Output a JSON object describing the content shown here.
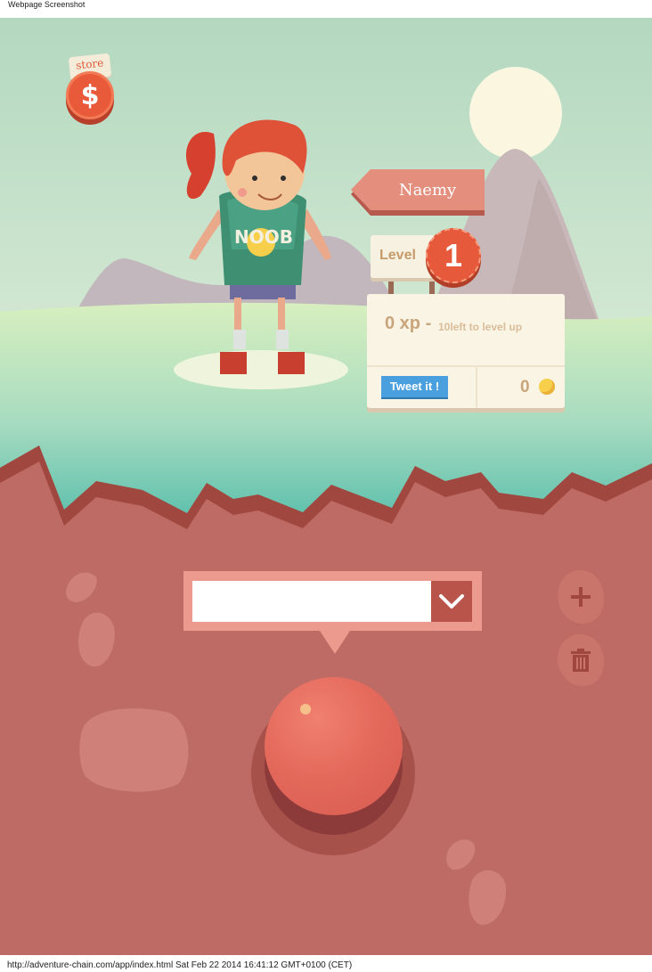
{
  "window": {
    "title": "Webpage Screenshot",
    "footer": "http://adventure-chain.com/app/index.html Sat Feb 22 2014 16:41:12 GMT+0100 (CET)"
  },
  "store": {
    "label": "store",
    "symbol": "$"
  },
  "player": {
    "name": "Naemy",
    "shirt_text": "NOOB",
    "level_label": "Level",
    "level": "1",
    "xp_text": "0 xp -",
    "xp_sub": "10left to level up",
    "tweet_label": "Tweet it !",
    "coins": "0"
  },
  "composer": {
    "input_value": "",
    "placeholder": ""
  },
  "colors": {
    "sky_top": "#b7dcc4",
    "grass": "#c7e9b3",
    "ground": "#bd6b64",
    "accent_red": "#e6593a",
    "tweet_blue": "#4a9fde"
  },
  "icons": {
    "store": "dollar-coin-icon",
    "toggle": "chevron-down-icon",
    "add": "plus-icon",
    "delete": "trash-icon",
    "coin": "coin-icon"
  }
}
